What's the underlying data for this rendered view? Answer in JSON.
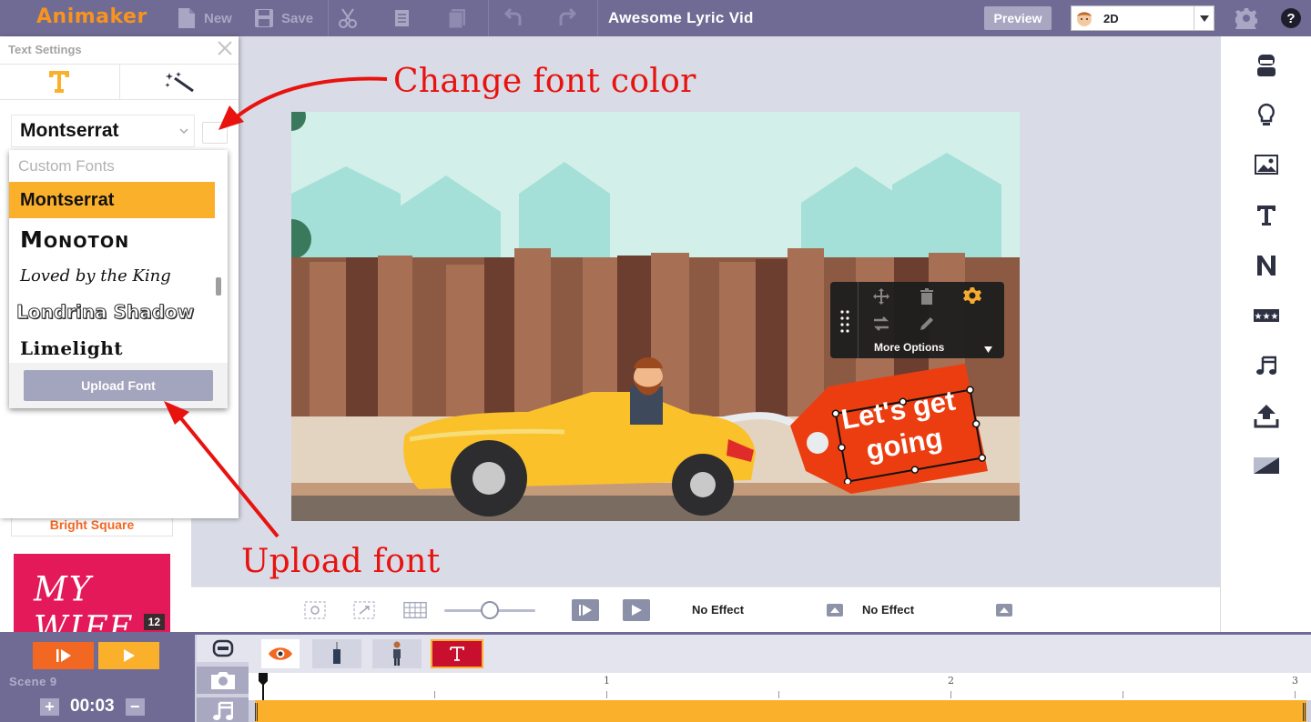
{
  "app": {
    "logo": "Animaker",
    "project_title": "Awesome Lyric Vid"
  },
  "toolbar": {
    "new_label": "New",
    "save_label": "Save",
    "preview_label": "Preview",
    "mode_value": "2D"
  },
  "text_settings": {
    "title": "Text Settings",
    "current_font": "Montserrat",
    "dropdown": {
      "header": "Custom Fonts",
      "fonts": [
        "Montserrat",
        "Monoton",
        "Loved by the King",
        "Londrina Shadow",
        "Limelight"
      ],
      "selected": "Montserrat",
      "upload_label": "Upload Font"
    }
  },
  "library": {
    "card_label": "Bright Square",
    "card_text": "MY WIFE",
    "card_count": "12"
  },
  "stage": {
    "text_object": [
      "Let's get",
      "going"
    ],
    "more_options_label": "More Options"
  },
  "annotations": {
    "change_color": "Change font color",
    "upload_font": "Upload font"
  },
  "controls": {
    "effect_in": "No Effect",
    "effect_out": "No Effect"
  },
  "timeline": {
    "scene_label": "Scene 9",
    "duration": "00:03",
    "ruler_labels": [
      "1",
      "2",
      "3"
    ]
  },
  "colors": {
    "accent_orange": "#f26722",
    "accent_yellow": "#fbb02c",
    "topbar": "#6f6b95",
    "annotation_red": "#e8120f"
  }
}
